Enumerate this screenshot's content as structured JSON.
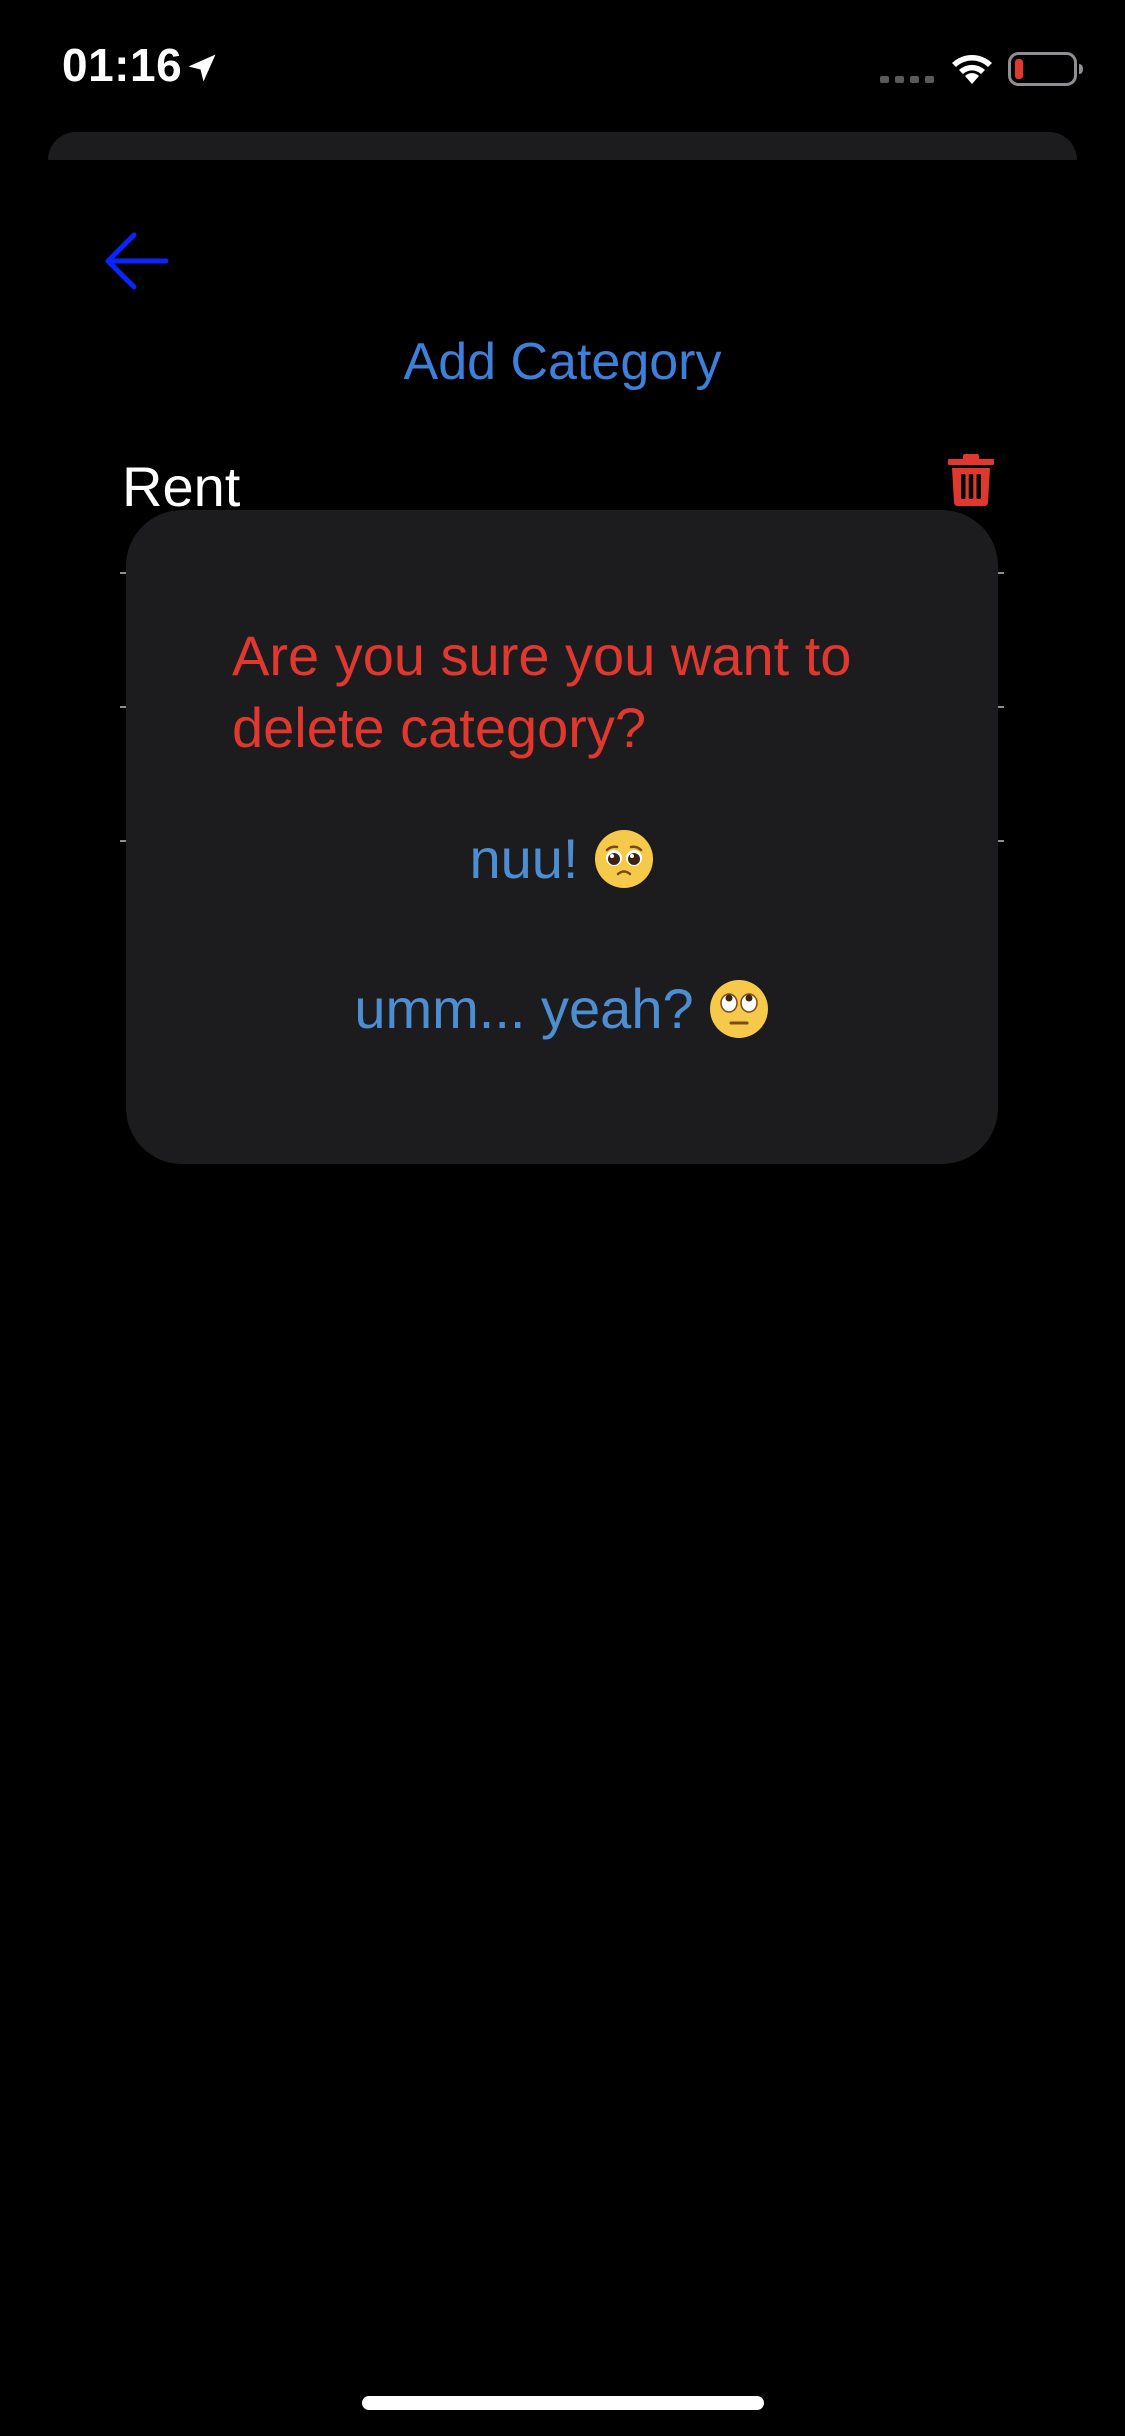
{
  "status_bar": {
    "time": "01:16",
    "icons": [
      "location-arrow-icon",
      "cellular-signal-icon",
      "wifi-icon",
      "battery-low-icon"
    ]
  },
  "header": {
    "back_icon": "arrow-left-icon",
    "add_category_label": "Add Category"
  },
  "categories": [
    {
      "label": "Rent",
      "delete_icon": "trash-icon"
    },
    {
      "label": ""
    },
    {
      "label": ""
    },
    {
      "label": ""
    }
  ],
  "dialog": {
    "message": "Are you sure you want to delete category?",
    "cancel_label": "nuu!",
    "cancel_emoji": "pleading-face-emoji",
    "confirm_label": "umm... yeah?",
    "confirm_emoji": "eye-roll-face-emoji"
  },
  "colors": {
    "background": "#000000",
    "accent_blue": "#3d7fd9",
    "back_arrow_blue": "#0a24ff",
    "destructive_red": "#e0382f",
    "dialog_background": "#1c1c1e"
  }
}
